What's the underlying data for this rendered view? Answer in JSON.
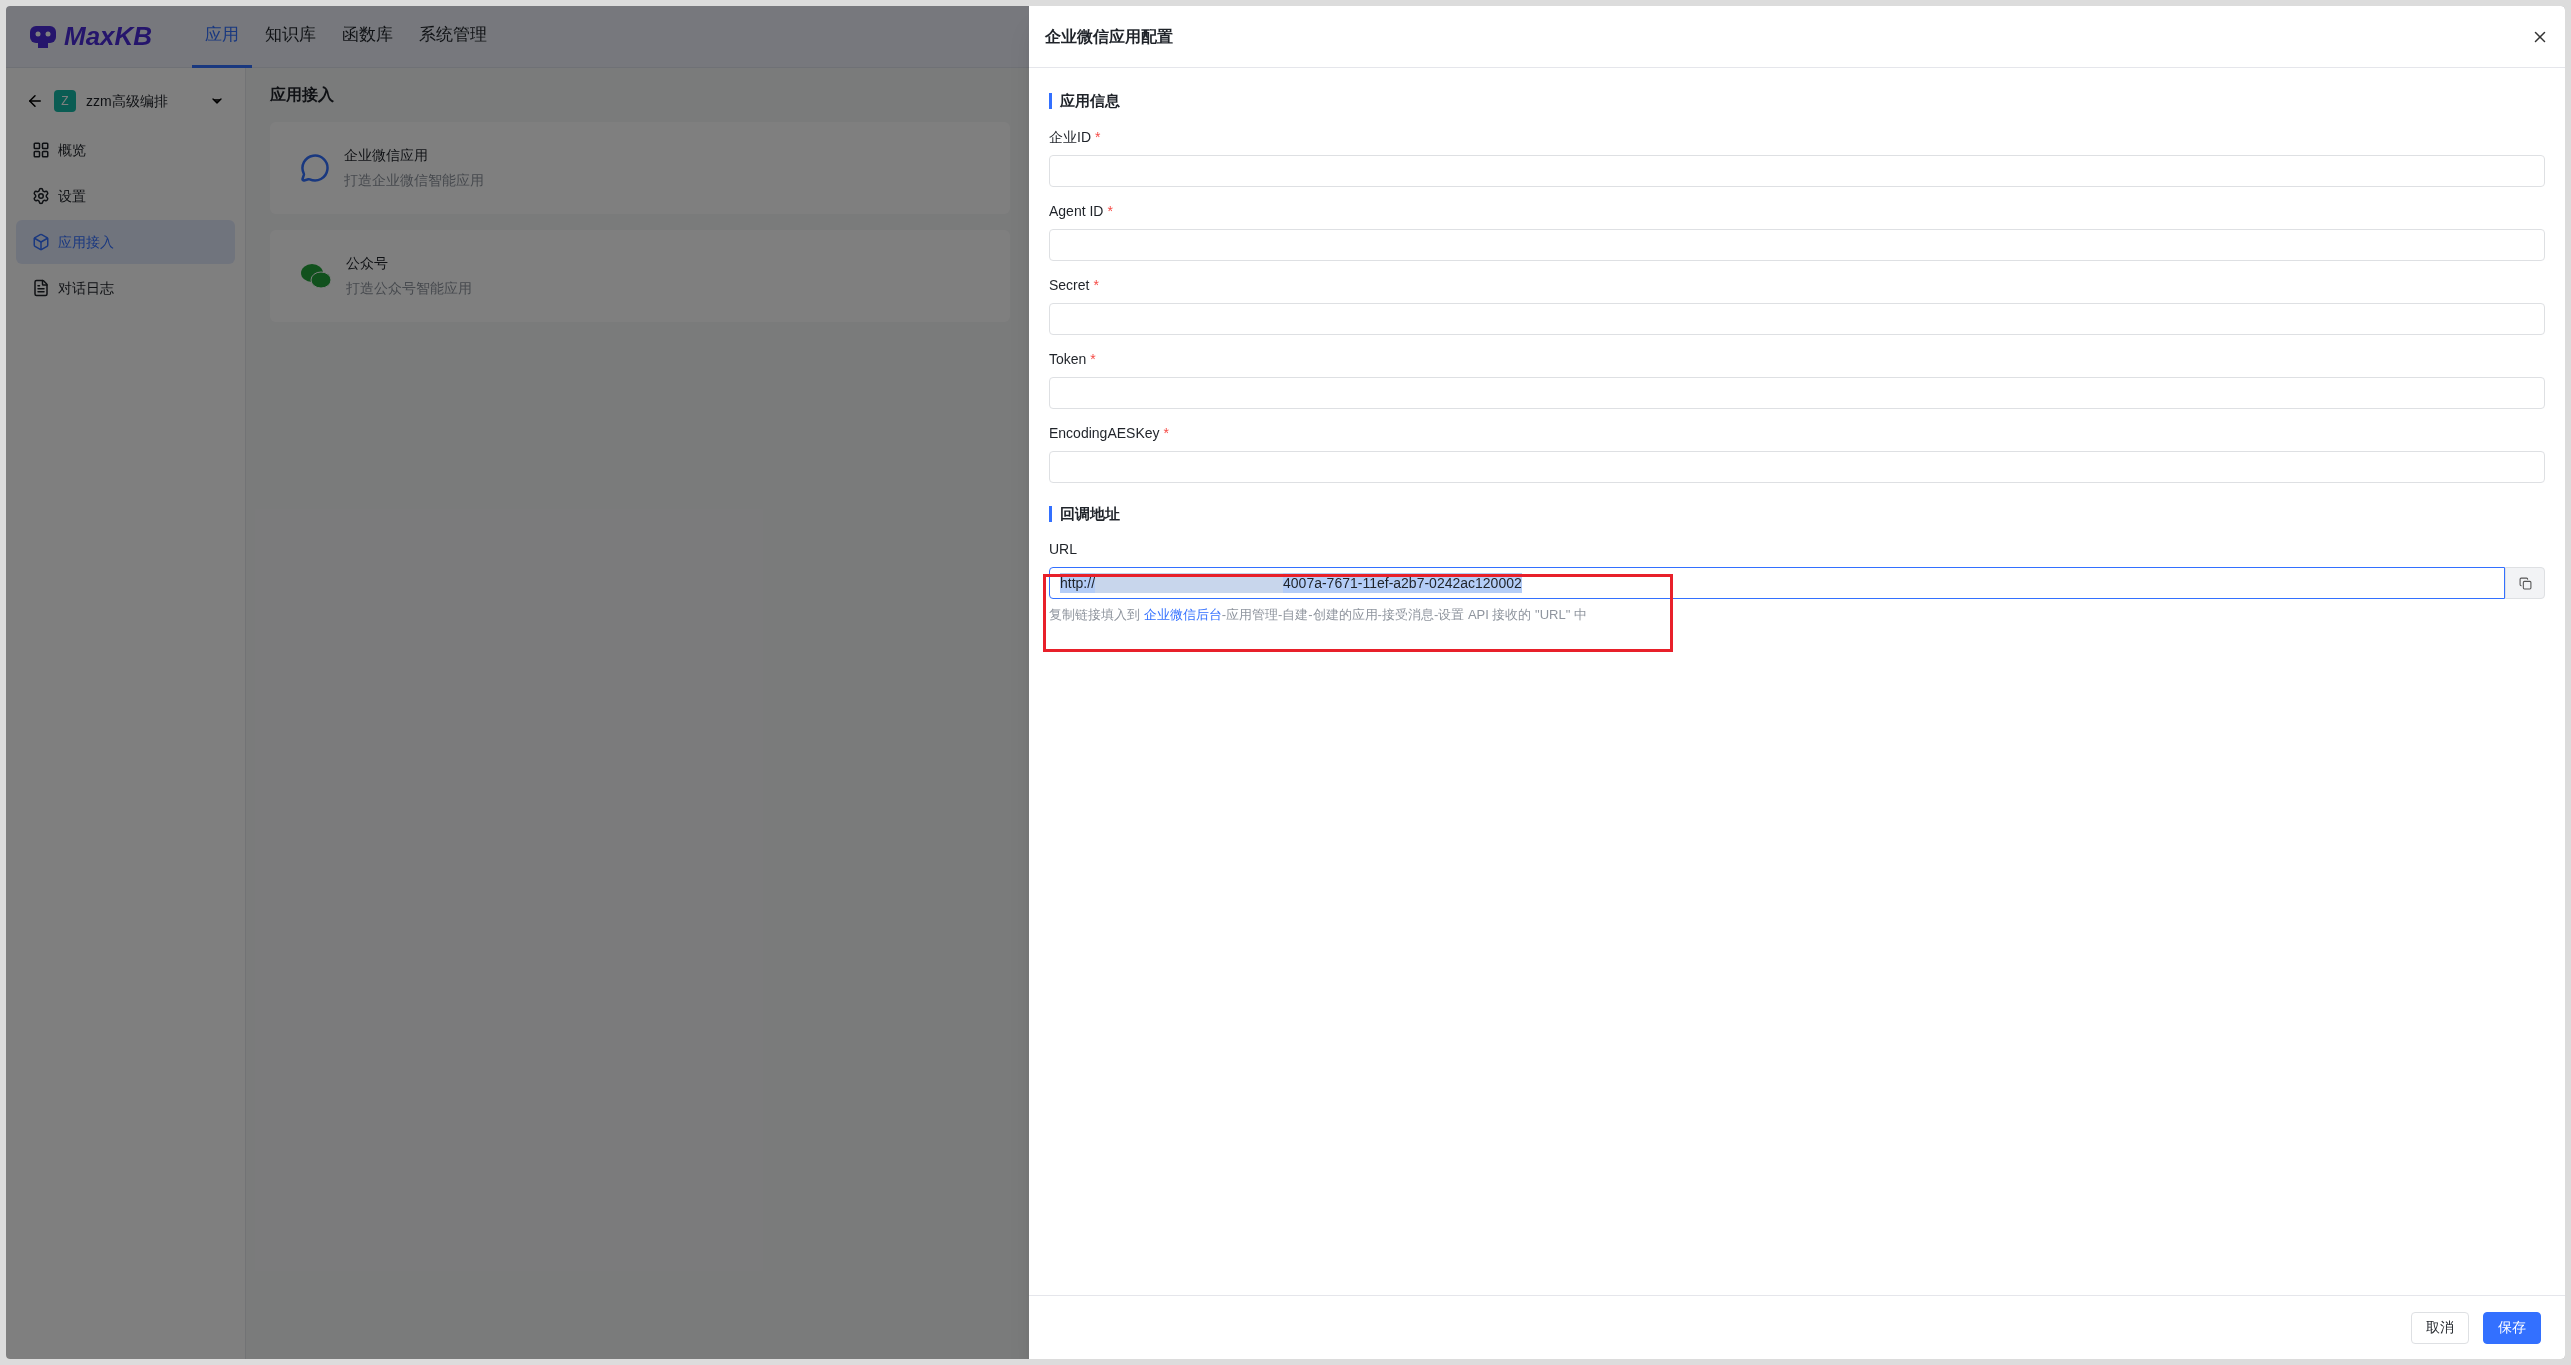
{
  "header": {
    "logo": "MaxKB",
    "nav": [
      {
        "label": "应用",
        "selected": true
      },
      {
        "label": "知识库",
        "selected": false
      },
      {
        "label": "函数库",
        "selected": false
      },
      {
        "label": "系统管理",
        "selected": false
      }
    ]
  },
  "sidebar": {
    "app_initial": "Z",
    "app_name": "zzm高级编排",
    "items": [
      {
        "label": "概览",
        "selected": false
      },
      {
        "label": "设置",
        "selected": false
      },
      {
        "label": "应用接入",
        "selected": true
      },
      {
        "label": "对话日志",
        "selected": false
      }
    ]
  },
  "main": {
    "title": "应用接入",
    "cards": [
      {
        "title": "企业微信应用",
        "subtitle": "打造企业微信智能应用"
      },
      {
        "title": "公众号",
        "subtitle": "打造公众号智能应用"
      }
    ]
  },
  "drawer": {
    "title": "企业微信应用配置",
    "section_1": "应用信息",
    "required_mark": "*",
    "fields": [
      {
        "label": "企业ID",
        "required": true
      },
      {
        "label": "Agent ID",
        "required": true
      },
      {
        "label": "Secret",
        "required": true
      },
      {
        "label": "Token",
        "required": true
      },
      {
        "label": "EncodingAESKey",
        "required": true
      }
    ],
    "section_2": "回调地址",
    "url_label": "URL",
    "url_prefix": "http://",
    "url_suffix": "4007a-7671-11ef-a2b7-0242ac120002",
    "hint_before": "复制链接填入到 ",
    "hint_link": "企业微信后台",
    "hint_after": "-应用管理-自建-创建的应用-接受消息-设置 API 接收的 \"URL\" 中",
    "buttons": [
      {
        "label": "取消",
        "kind": "secondary"
      },
      {
        "label": "保存",
        "kind": "primary"
      }
    ]
  }
}
